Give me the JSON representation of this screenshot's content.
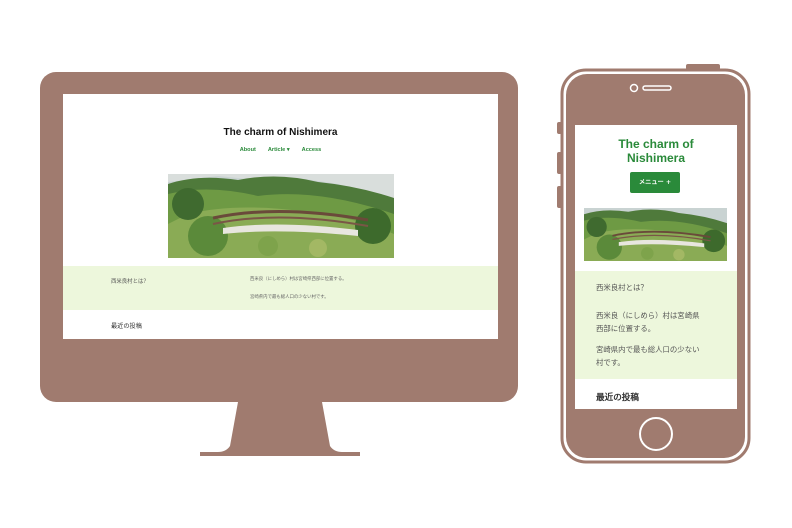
{
  "site": {
    "title": "The charm of Nishimera",
    "title_line1": "The charm of",
    "title_line2": "Nishimera"
  },
  "nav": {
    "items": [
      "About",
      "Article ▾",
      "Access"
    ],
    "mobile_menu": "メニュー +"
  },
  "intro": {
    "title": "西米良村とは？",
    "line1": "西米良（にしめら）村は宮崎県西部に位置する。",
    "line2": "宮崎県内で最も総人口の少ない村です。",
    "mobile_lines": [
      "西米良（にしめら）村は宮崎県",
      "西部に位置する。"
    ],
    "mobile_lines2": [
      "宮崎県内で最も総人口の少ない",
      "村です。"
    ]
  },
  "recent_posts": "最近の投稿",
  "colors": {
    "device": "#a07b6f",
    "accent": "#2a8a3a",
    "band": "#edf7dc"
  },
  "icons": {
    "hero": "bridge-landscape-image",
    "home": "home-button"
  }
}
